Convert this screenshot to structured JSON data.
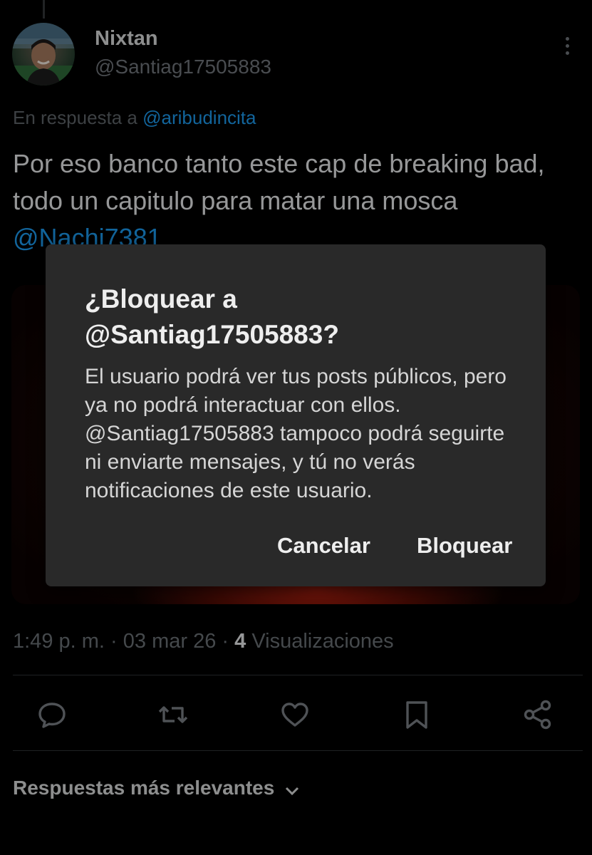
{
  "post": {
    "author_name": "Nixtan",
    "author_handle": "@Santiag17505883",
    "reply_prefix": "En respuesta a ",
    "reply_to_handle": "@aribudincita",
    "text": "Por eso banco tanto este cap de breaking bad, todo un capitulo para matar una mosca ",
    "text_mention": "@Nachi7381",
    "time": "1:49 p. m.",
    "date": "03 mar 26",
    "views_count": "4",
    "views_label": "Visualizaciones",
    "separator": " · "
  },
  "actions": {
    "icons": [
      "reply-icon",
      "repost-icon",
      "like-icon",
      "bookmark-icon",
      "share-icon"
    ]
  },
  "replies": {
    "sort_label": "Respuestas más relevantes"
  },
  "dialog": {
    "title_line1": "¿Bloquear a",
    "title_line2": "@Santiag17505883?",
    "body": "El usuario podrá ver tus posts públicos, pero ya no podrá interactuar con ellos. @Santiag17505883 tampoco podrá seguirte ni enviarte mensajes, y tú no verás notificaciones de este usuario.",
    "cancel_label": "Cancelar",
    "confirm_label": "Bloquear"
  },
  "colors": {
    "background": "#000000",
    "link": "#1d9bf0",
    "muted": "#71767b",
    "dialog_background": "#292929"
  }
}
